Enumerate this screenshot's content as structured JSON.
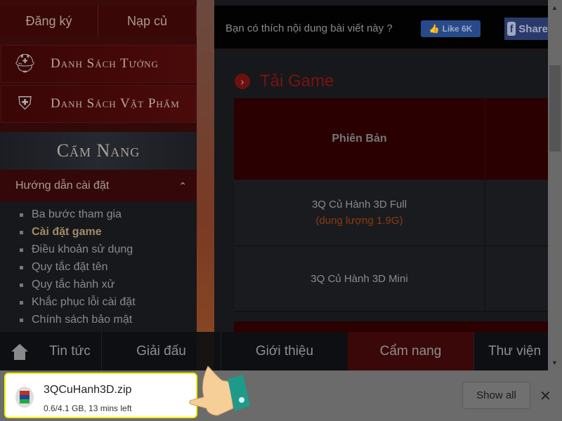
{
  "sidebar": {
    "register": "Đăng ký",
    "topup": "Nạp củ",
    "heroes": "Danh Sách Tướng",
    "items": "Danh Sách Vật Phẩm",
    "guide_title": "Cẩm Nang",
    "section": "Hướng dẫn cài đặt",
    "links": [
      {
        "label": "Ba bước tham gia"
      },
      {
        "label": "Cài đặt game",
        "active": true
      },
      {
        "label": "Điều khoản sử dụng"
      },
      {
        "label": "Quy tắc đặt tên"
      },
      {
        "label": "Quy tắc hành xử"
      },
      {
        "label": "Khắc phục lỗi cài đặt"
      },
      {
        "label": "Chính sách bảo mật"
      }
    ]
  },
  "likebar": {
    "question": "Bạn có thích nội dung bài viết này ?",
    "like": "Like 6K",
    "share": "Share"
  },
  "download_section": {
    "title": "Tải Game",
    "header": "Phiên Bản",
    "rows": [
      {
        "name": "3Q Củ Hành 3D Full",
        "note": "(dung lượng 1.9G)"
      },
      {
        "name": "3Q Củ Hành 3D Mini",
        "note": ""
      }
    ]
  },
  "nav": {
    "items": [
      "Tin tức",
      "Giải đấu",
      "Giới thiệu",
      "Cẩm nang",
      "Thư viện"
    ],
    "active": "Cẩm nang"
  },
  "download_bar": {
    "filename": "3QCuHanh3D.zip",
    "status": "0.6/4.1 GB, 13 mins left",
    "show_all": "Show all",
    "close": "✕"
  },
  "colors": {
    "highlight": "#f2f200",
    "accent_red": "#7a1212",
    "like_blue": "#274a8a"
  }
}
